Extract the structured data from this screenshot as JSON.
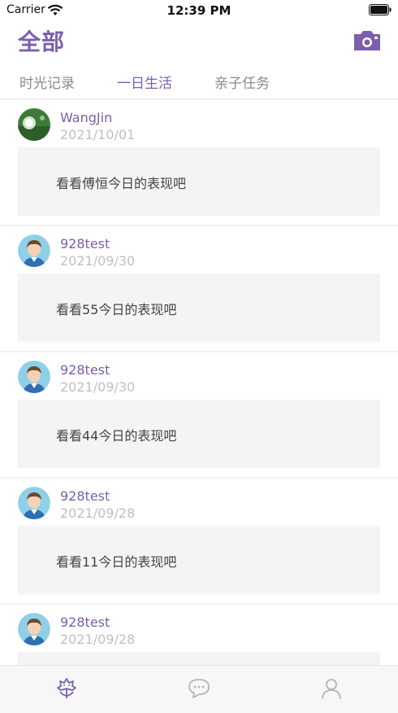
{
  "status_bar": {
    "carrier": "Carrier",
    "time": "12:39 PM"
  },
  "header": {
    "title": "全部",
    "camera_icon": "camera-icon"
  },
  "tabs": [
    {
      "label": "时光记录",
      "active": false
    },
    {
      "label": "一日生活",
      "active": true
    },
    {
      "label": "亲子任务",
      "active": false
    }
  ],
  "posts": [
    {
      "user": "WangJin",
      "date": "2021/10/01",
      "text": "看看傅恒今日的表现吧",
      "avatar": "dandelion-photo"
    },
    {
      "user": "928test",
      "date": "2021/09/30",
      "text": "看看55今日的表现吧",
      "avatar": "boy-avatar"
    },
    {
      "user": "928test",
      "date": "2021/09/30",
      "text": "看看44今日的表现吧",
      "avatar": "boy-avatar"
    },
    {
      "user": "928test",
      "date": "2021/09/28",
      "text": "看看11今日的表现吧",
      "avatar": "boy-avatar"
    },
    {
      "user": "928test",
      "date": "2021/09/28",
      "text": "",
      "avatar": "boy-avatar"
    }
  ],
  "tab_bar": {
    "items": [
      {
        "icon": "flower-icon",
        "active": true
      },
      {
        "icon": "chat-icon",
        "active": false
      },
      {
        "icon": "person-icon",
        "active": false
      }
    ]
  },
  "colors": {
    "accent": "#7b5fae",
    "date": "#c0c0c0",
    "card_bg": "#f4f4f4"
  }
}
